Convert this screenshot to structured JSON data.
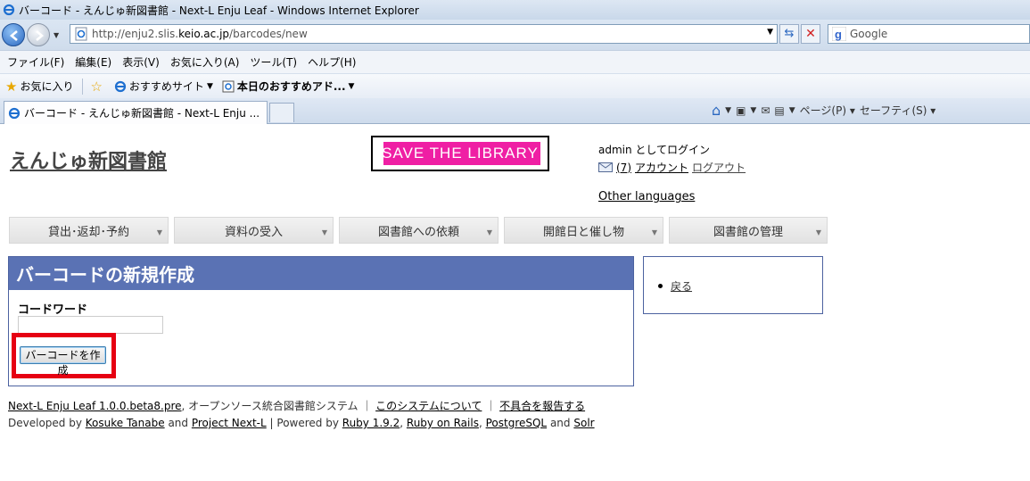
{
  "browser": {
    "window_title": "バーコード - えんじゅ新図書館 - Next-L Enju Leaf - Windows Internet Explorer",
    "url_prefix": "http://enju2.slis.",
    "url_domain": "keio.ac.jp",
    "url_suffix": "/barcodes/new",
    "search_placeholder": "Google",
    "menu": [
      "ファイル(F)",
      "編集(E)",
      "表示(V)",
      "お気に入り(A)",
      "ツール(T)",
      "ヘルプ(H)"
    ],
    "favorites": {
      "label": "お気に入り",
      "item1": "おすすめサイト",
      "item2": "本日のおすすめアド..."
    },
    "tab_title": "バーコード - えんじゅ新図書館 - Next-L Enju ...",
    "commands": {
      "page": "ページ(P)",
      "safety": "セーフティ(S)"
    }
  },
  "site": {
    "title": "えんじゅ新図書館",
    "banner_text": "SAVE THE LIBRARY"
  },
  "user": {
    "login_text": "admin としてログイン",
    "message_count": "(7)",
    "account_link": "アカウント",
    "logout_link": "ログアウト",
    "other_languages": "Other languages"
  },
  "nav": [
    "貸出･返却･予約",
    "資料の受入",
    "図書館への依頼",
    "開館日と催し物",
    "図書館の管理"
  ],
  "main": {
    "heading": "バーコードの新規作成",
    "field_label": "コードワード",
    "field_value": "",
    "submit_label": "バーコードを作成"
  },
  "sidebar": {
    "back_link": "戻る"
  },
  "footer": {
    "app_link": "Next-L Enju Leaf 1.0.0.beta8.pre",
    "app_desc": ", オープンソース統合図書館システム ｜",
    "about_link": "このシステムについて",
    "sep": "｜",
    "report_link": "不具合を報告する",
    "dev_prefix": "Developed by",
    "dev1": "Kosuke Tanabe",
    "and1": "and",
    "dev2": "Project Next-L",
    "powered": "| Powered by",
    "ruby": "Ruby 1.9.2",
    "rails": "Ruby on Rails",
    "pg": "PostgreSQL",
    "and2": "and",
    "solr": "Solr"
  },
  "colors": {
    "page_header": "#5a72b4",
    "highlight": "#e60012",
    "banner": "#ef1fa4"
  }
}
